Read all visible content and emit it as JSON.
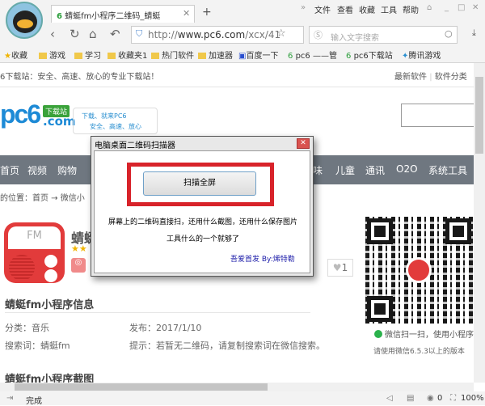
{
  "browser": {
    "tab_title": "蜻蜓fm小程序二维码_蜻蜓",
    "tab_icon_text": "6",
    "menu": [
      "文件",
      "查看",
      "收藏",
      "工具",
      "帮助"
    ],
    "url_prefix": "http://",
    "url_host": "www.pc6.com",
    "url_path": "/xcx/41",
    "search_placeholder": "输入文字搜索",
    "bookmarks": [
      "收藏",
      "游戏",
      "学习",
      "收藏夹1",
      "热门软件",
      "加速器",
      "百度一下",
      "pc6 ——管",
      "pc6下载站",
      "腾讯游戏"
    ],
    "status": "完成",
    "status_count": "0",
    "zoom": "100%"
  },
  "page": {
    "top_slogan": "6下载站：安全、高速、放心的专业下载站！",
    "top_links": [
      "最新软件",
      "软件分类"
    ],
    "logo": "pc6",
    "logo_badge": "下载站",
    "logo_com": ".com",
    "slogan_line1": "下载、就来PC6",
    "slogan_line2": "安全、高速、放心",
    "nav": [
      "首页",
      "视频",
      "购物",
      "味",
      "儿童",
      "通讯",
      "O2O",
      "系统工具"
    ],
    "breadcrumb": "的位置：首页 → 微信小",
    "app_title": "蜻蜓",
    "app_icon_text": "FM",
    "stars": "★★",
    "likes": "1",
    "info_title": "蜻蜓fm小程序信息",
    "category": "分类：音乐",
    "release": "发布：2017/1/10",
    "keyword": "搜索词：蜻蜓fm",
    "tip": "提示：若暂无二维码，请复制搜索词在微信搜索。",
    "qr_caption": "微信扫一扫，使用小程序",
    "qr_note": "请使用微信6.5.3以上的版本",
    "shots_title": "蜻蜓fm小程序截图"
  },
  "dialog": {
    "title": "电脑桌面二维码扫描器",
    "scan_button": "扫描全屏",
    "text1": "屏幕上的二维码直接扫，还用什么截图，还用什么保存图片",
    "text2": "工具什么的一个就够了",
    "link": "吾爱首发  By:烯特勒",
    "highlight_color": "#d8232a"
  }
}
